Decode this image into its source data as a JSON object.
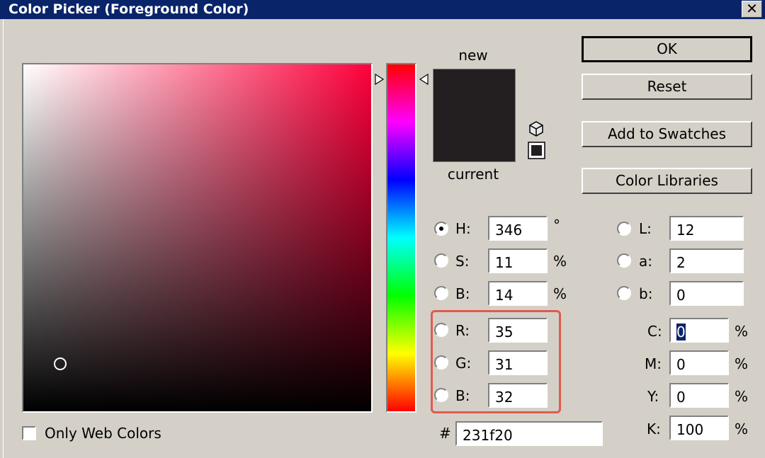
{
  "window": {
    "title": "Color Picker (Foreground Color)",
    "close_glyph": "✕"
  },
  "preview": {
    "new_label": "new",
    "current_label": "current",
    "new_color": "#231f20",
    "current_color": "#231f20"
  },
  "buttons": {
    "ok": "OK",
    "reset": "Reset",
    "add_to_swatches": "Add to Swatches",
    "color_libraries": "Color Libraries"
  },
  "hsb": {
    "h": {
      "label": "H:",
      "value": "346",
      "unit": "°",
      "selected": true
    },
    "s": {
      "label": "S:",
      "value": "11",
      "unit": "%"
    },
    "b": {
      "label": "B:",
      "value": "14",
      "unit": "%"
    }
  },
  "rgb": {
    "r": {
      "label": "R:",
      "value": "35"
    },
    "g": {
      "label": "G:",
      "value": "31"
    },
    "b": {
      "label": "B:",
      "value": "32"
    }
  },
  "lab": {
    "l": {
      "label": "L:",
      "value": "12"
    },
    "a": {
      "label": "a:",
      "value": "2"
    },
    "b": {
      "label": "b:",
      "value": "0"
    }
  },
  "cmyk": {
    "c": {
      "label": "C:",
      "value": "0",
      "unit": "%"
    },
    "m": {
      "label": "M:",
      "value": "0",
      "unit": "%"
    },
    "y": {
      "label": "Y:",
      "value": "0",
      "unit": "%"
    },
    "k": {
      "label": "K:",
      "value": "100",
      "unit": "%"
    }
  },
  "hex": {
    "label": "#",
    "value": "231f20"
  },
  "web_colors": {
    "label": "Only Web Colors",
    "checked": false
  },
  "colors": {
    "hue_base": "#ff0040",
    "highlight_box": "#e05a4e"
  }
}
